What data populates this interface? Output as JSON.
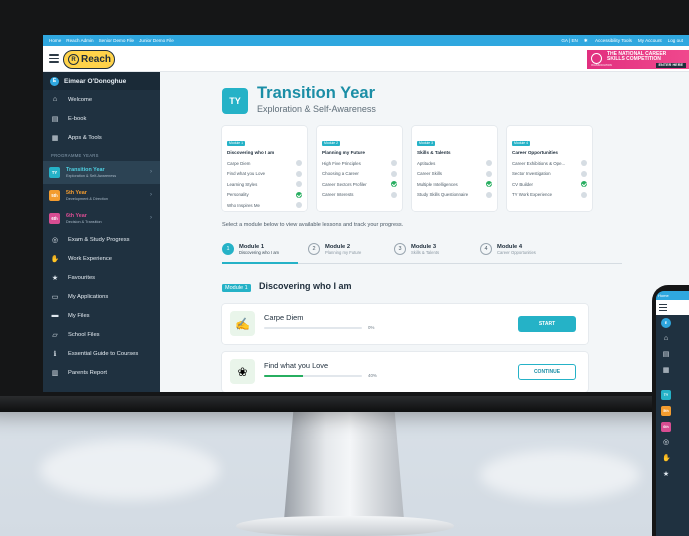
{
  "topbar": {
    "left_links": [
      "Home",
      "Reach Admin",
      "Senior Demo File",
      "Junior Demo File"
    ],
    "lang": "GA | EN",
    "accessibility": "Accessibility Tools",
    "account": "My Account",
    "logout": "Log out"
  },
  "logo": {
    "mark": "R",
    "text": "Reach"
  },
  "banner": {
    "line1": "THE NATIONAL CAREER",
    "line2": "SKILLS COMPETITION",
    "enter": "ENTER HERE",
    "sub": "IN ASSOCIATION"
  },
  "sidebar": {
    "user_initial": "E",
    "user_name": "Eimear O'Donoghue",
    "items_top": [
      {
        "label": "Welcome",
        "icon": "home-icon"
      },
      {
        "label": "E-book",
        "icon": "book-icon"
      },
      {
        "label": "Apps & Tools",
        "icon": "grid-icon"
      }
    ],
    "section_label": "PROGRAMME YEARS",
    "years": [
      {
        "badge": "TY",
        "title": "Transition Year",
        "sub": "Exploration & Self-Awareness",
        "color": "#25b2c7"
      },
      {
        "badge": "5th",
        "title": "5th Year",
        "sub": "Development & Direction",
        "color": "#f39c2f"
      },
      {
        "badge": "6th",
        "title": "6th Year",
        "sub": "Decision & Transition",
        "color": "#d84d92"
      }
    ],
    "items_bottom": [
      {
        "label": "Exam & Study Progress",
        "icon": "target-icon"
      },
      {
        "label": "Work Experience",
        "icon": "handshake-icon"
      },
      {
        "label": "Favourites",
        "icon": "star-icon"
      },
      {
        "label": "My Applications",
        "icon": "clipboard-icon"
      },
      {
        "label": "My Files",
        "icon": "folder-icon"
      },
      {
        "label": "School Files",
        "icon": "folder-open-icon"
      },
      {
        "label": "Essential Guide to Courses",
        "icon": "info-icon"
      },
      {
        "label": "Parents Report",
        "icon": "report-icon"
      }
    ]
  },
  "main": {
    "badge": "TY",
    "title": "Transition Year",
    "subtitle": "Exploration & Self-Awareness",
    "modules": [
      {
        "tag": "Module 1",
        "name": "Discovering who I am",
        "rows": [
          {
            "label": "Carpe Diem",
            "status": "empty",
            "progress": 0
          },
          {
            "label": "Find what you Love",
            "status": "partial",
            "progress": 40
          },
          {
            "label": "Learning Styles",
            "status": "empty",
            "progress": 0
          },
          {
            "label": "Personality",
            "status": "done",
            "progress": 100
          },
          {
            "label": "Who Inspires Me",
            "status": "empty",
            "progress": 0
          }
        ]
      },
      {
        "tag": "Module 2",
        "name": "Planning my Future",
        "rows": [
          {
            "label": "High Five Principles",
            "status": "partial",
            "progress": 15
          },
          {
            "label": "Choosing a Career",
            "status": "partial",
            "progress": 30
          },
          {
            "label": "Career Sectors Profiler",
            "status": "done",
            "progress": 100
          },
          {
            "label": "Career Interests",
            "status": "empty",
            "progress": 0
          }
        ]
      },
      {
        "tag": "Module 3",
        "name": "Skills & Talents",
        "rows": [
          {
            "label": "Aptitudes",
            "status": "partial",
            "progress": 60
          },
          {
            "label": "Career Skills",
            "status": "empty",
            "progress": 0
          },
          {
            "label": "Multiple Intelligences",
            "status": "done",
            "progress": 100
          },
          {
            "label": "Study Skills Questionnaire",
            "status": "empty",
            "progress": 0
          }
        ]
      },
      {
        "tag": "Module 4",
        "name": "Career Opportunities",
        "rows": [
          {
            "label": "Career Exhibitions & Ope...",
            "status": "empty",
            "progress": 0
          },
          {
            "label": "Sector Investigation",
            "status": "partial",
            "progress": 75
          },
          {
            "label": "CV Builder",
            "status": "done",
            "progress": 100
          },
          {
            "label": "TY Work Experience",
            "status": "partial",
            "progress": 20
          }
        ]
      }
    ],
    "instructions": "Select a module below to view available lessons and track your progress.",
    "steps": [
      {
        "num": "1",
        "title": "Module 1",
        "sub": "Discovering who I am"
      },
      {
        "num": "2",
        "title": "Module 2",
        "sub": "Planning my Future"
      },
      {
        "num": "3",
        "title": "Module 3",
        "sub": "Skills & Talents"
      },
      {
        "num": "4",
        "title": "Module 4",
        "sub": "Career Opportunities"
      }
    ],
    "section_tag": "Module 1",
    "section_title": "Discovering who I am",
    "lessons": [
      {
        "title": "Carpe Diem",
        "progress": 0,
        "pct": "0%",
        "button": "START",
        "icon": "carpe-diem-icon"
      },
      {
        "title": "Find what you Love",
        "progress": 40,
        "pct": "40%",
        "button": "CONTINUE",
        "icon": "love-icon"
      }
    ]
  },
  "phone": {
    "top": "Home"
  },
  "colors": {
    "accent": "#25b2c7",
    "sidebar": "#1f3140",
    "topbar": "#2fa7df",
    "success": "#27ae60"
  }
}
